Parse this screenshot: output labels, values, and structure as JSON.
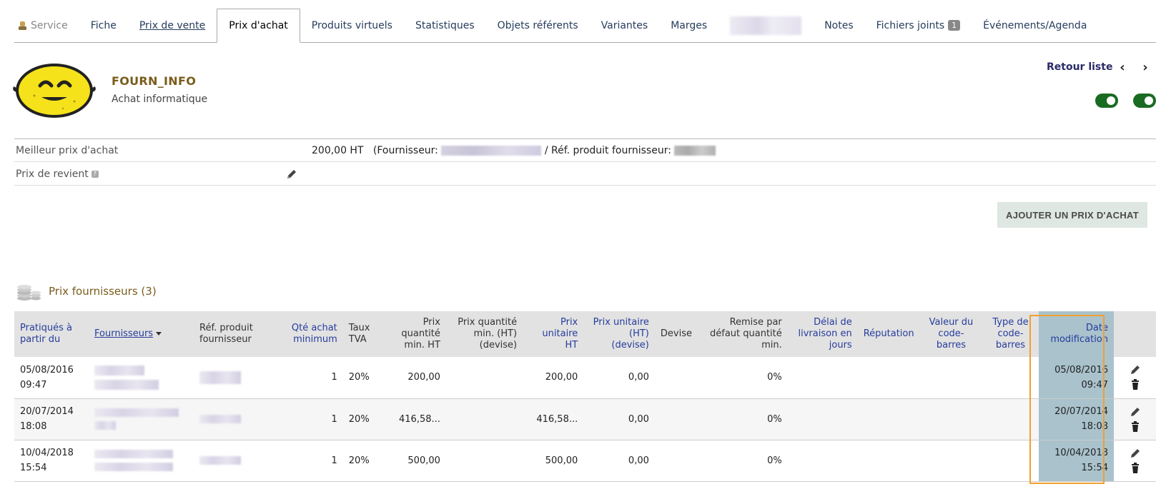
{
  "tabs": [
    {
      "label": "Service",
      "state": "first"
    },
    {
      "label": "Fiche"
    },
    {
      "label": "Prix de vente",
      "underline": true
    },
    {
      "label": "Prix d'achat",
      "active": true
    },
    {
      "label": "Produits virtuels"
    },
    {
      "label": "Statistiques"
    },
    {
      "label": "Objets référents"
    },
    {
      "label": "Variantes"
    },
    {
      "label": "Marges"
    },
    {
      "label": "Notes"
    },
    {
      "label": "Fichiers joints",
      "badge": "1"
    },
    {
      "label": "Événements/Agenda"
    }
  ],
  "product": {
    "ref": "FOURN_INFO",
    "label": "Achat informatique"
  },
  "nav": {
    "back_label": "Retour liste",
    "prev": "‹",
    "next": "›"
  },
  "best_price": {
    "key": "Meilleur prix d'achat",
    "amount": "200,00 HT",
    "supplier_prefix": "(Fournisseur:",
    "ref_prefix": "/ Réf. produit fournisseur:"
  },
  "cost_price": {
    "key": "Prix de revient"
  },
  "add_button": "AJOUTER UN PRIX D'ACHAT",
  "section": {
    "title": "Prix fournisseurs (3)"
  },
  "table": {
    "headers": {
      "date_from": "Pratiqués à partir du",
      "supplier": "Fournisseurs",
      "ref_supplier": "Réf. produit fournisseur",
      "qty_min": "Qté achat minimum",
      "vat": "Taux TVA",
      "price_qty": "Prix quantité min. HT",
      "price_qty_currency": "Prix quantité min. (HT) (devise)",
      "unit_price": "Prix unitaire HT",
      "unit_price_currency": "Prix unitaire (HT) (devise)",
      "currency": "Devise",
      "discount": "Remise par défaut quantité min.",
      "delivery": "Délai de livraison en jours",
      "reputation": "Réputation",
      "barcode": "Valeur du code-barres",
      "barcode_type": "Type de code-barres",
      "date_modif": "Date modification"
    },
    "rows": [
      {
        "date_from_d": "05/08/2016",
        "date_from_t": "09:47",
        "qty": "1",
        "vat": "20%",
        "price_qty": "200,00",
        "unit_price": "200,00",
        "unit_price_cur": "0,00",
        "discount": "0%",
        "modif_d": "05/08/2016",
        "modif_t": "09:47"
      },
      {
        "date_from_d": "20/07/2014",
        "date_from_t": "18:08",
        "qty": "1",
        "vat": "20%",
        "price_qty": "416,58...",
        "unit_price": "416,58...",
        "unit_price_cur": "0,00",
        "discount": "0%",
        "modif_d": "20/07/2014",
        "modif_t": "18:08"
      },
      {
        "date_from_d": "10/04/2018",
        "date_from_t": "15:54",
        "qty": "1",
        "vat": "20%",
        "price_qty": "500,00",
        "unit_price": "500,00",
        "unit_price_cur": "0,00",
        "discount": "0%",
        "modif_d": "10/04/2018",
        "modif_t": "15:54"
      }
    ]
  },
  "colors": {
    "highlight_column": "#a9c2cc",
    "highlight_border": "#f0a030",
    "toggle_on": "#1a6b22",
    "header_bg": "#e2e2e2",
    "add_button_bg": "#dee7e1"
  }
}
